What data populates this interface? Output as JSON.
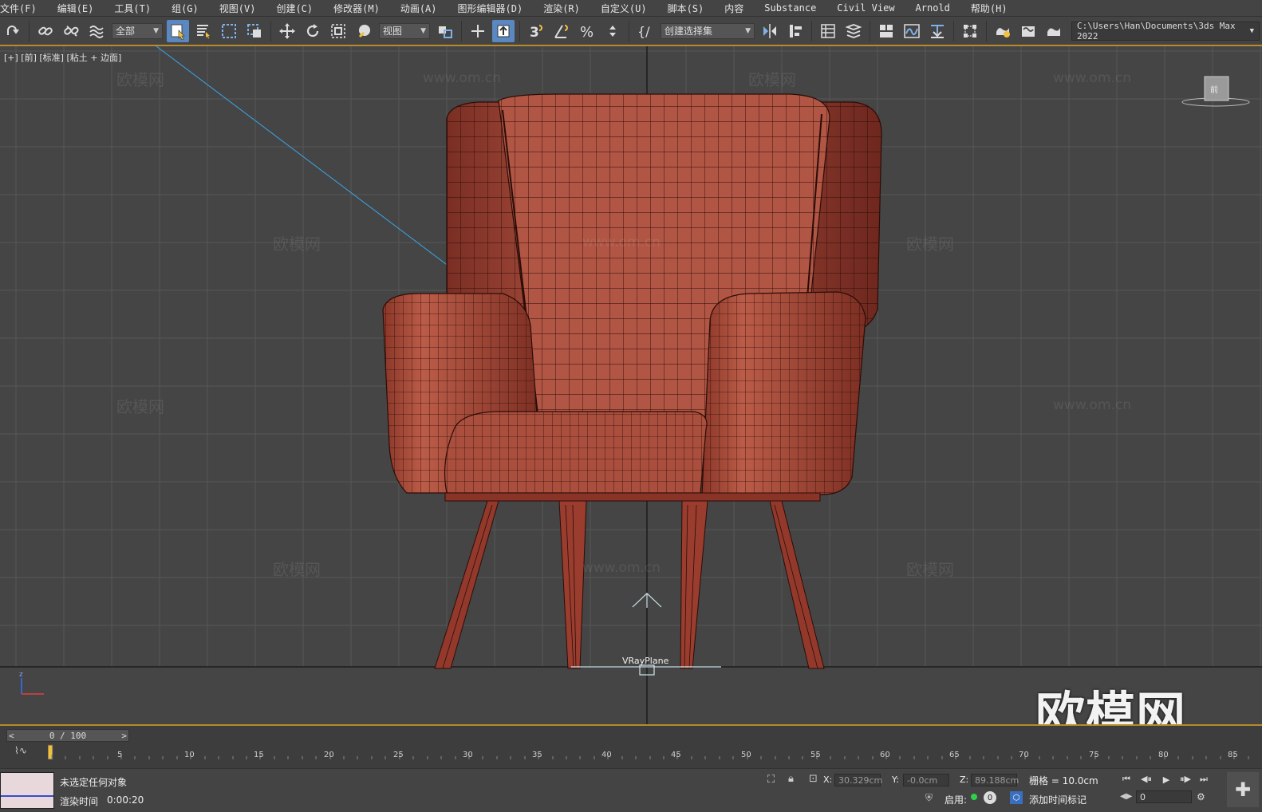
{
  "menu": [
    "文件(F)",
    "编辑(E)",
    "工具(T)",
    "组(G)",
    "视图(V)",
    "创建(C)",
    "修改器(M)",
    "动画(A)",
    "图形编辑器(D)",
    "渲染(R)",
    "自定义(U)",
    "脚本(S)",
    "内容",
    "Substance",
    "Civil View",
    "Arnold",
    "帮助(H)"
  ],
  "toolbar": {
    "selection_filter": "全部",
    "reference_coord": "视图",
    "named_selection": "创建选择集",
    "path": "C:\\Users\\Han\\Documents\\3ds Max 2022"
  },
  "viewport": {
    "label": "[+] [前] [标准] [粘土 + 边面]",
    "object_label": "VRayPlane",
    "viewcube_label": "前",
    "watermark_text": "欧模网",
    "watermark_url": "www.om.cn"
  },
  "timeline": {
    "frame_display": "0 / 100",
    "ticks": [
      "5",
      "10",
      "15",
      "20",
      "25",
      "30",
      "35",
      "40",
      "45",
      "50",
      "55",
      "60",
      "65",
      "70",
      "75",
      "80",
      "85"
    ]
  },
  "status": {
    "selection_text": "未选定任何对象",
    "render_time_label": "渲染时间",
    "render_time_value": "0:00:20",
    "x_label": "X:",
    "x_value": "30.329cm",
    "y_label": "Y:",
    "y_value": "-0.0cm",
    "z_label": "Z:",
    "z_value": "89.188cm",
    "grid_text": "栅格 = 10.0cm",
    "enable_label": "启用:",
    "enable_value": "0",
    "add_time_tag": "添加时间标记",
    "frame_input": "0"
  },
  "colors": {
    "chair": "#a0483a",
    "wire": "#2a0d08",
    "grid": "#555555",
    "accent": "#b88a2a",
    "active_tool": "#5b88c0"
  }
}
